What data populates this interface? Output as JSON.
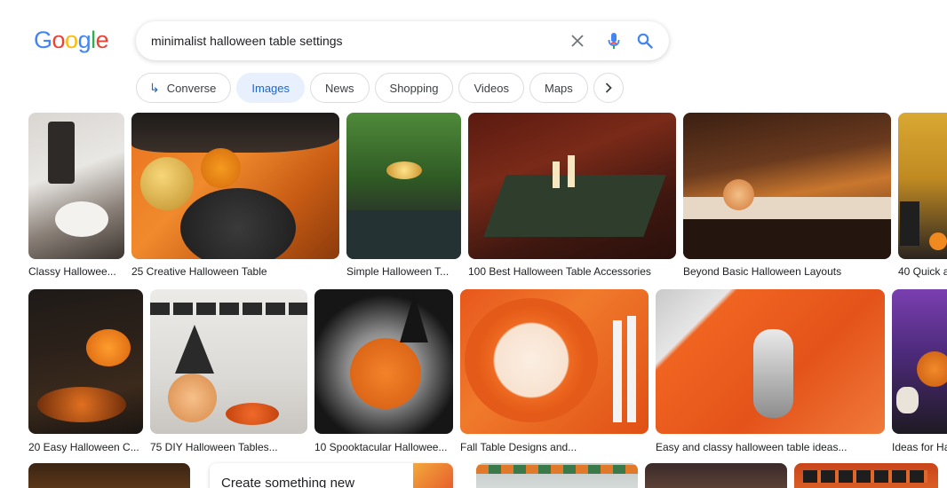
{
  "logo": {
    "letters": [
      "G",
      "o",
      "o",
      "g",
      "l",
      "e"
    ],
    "colors": [
      "#4285F4",
      "#EA4335",
      "#FBBC05",
      "#4285F4",
      "#34A853",
      "#EA4335"
    ]
  },
  "search": {
    "query": "minimalist halloween table settings"
  },
  "icons": {
    "clear": "close-icon",
    "mic": "mic-icon",
    "search": "search-icon"
  },
  "tabs": [
    {
      "label": "Converse",
      "icon": "converse-arrow-icon"
    },
    {
      "label": "Images",
      "active": true
    },
    {
      "label": "News"
    },
    {
      "label": "Shopping"
    },
    {
      "label": "Videos"
    },
    {
      "label": "Maps"
    }
  ],
  "row1": [
    {
      "caption": "Classy Hallowee..."
    },
    {
      "caption": "25 Creative Halloween Table"
    },
    {
      "caption": "Simple Halloween T..."
    },
    {
      "caption": "100 Best Halloween Table Accessories"
    },
    {
      "caption": "Beyond Basic Halloween Layouts"
    },
    {
      "caption": "40 Quick a"
    }
  ],
  "row2": [
    {
      "caption": "20 Easy Halloween C..."
    },
    {
      "caption": "75 DIY Halloween Tables..."
    },
    {
      "caption": "10 Spooktacular Hallowee..."
    },
    {
      "caption": "Fall Table Designs and..."
    },
    {
      "caption": "Easy and classy halloween table ideas..."
    },
    {
      "caption": "Ideas for Ha"
    }
  ],
  "row3": {
    "card_text": "Create something new"
  }
}
